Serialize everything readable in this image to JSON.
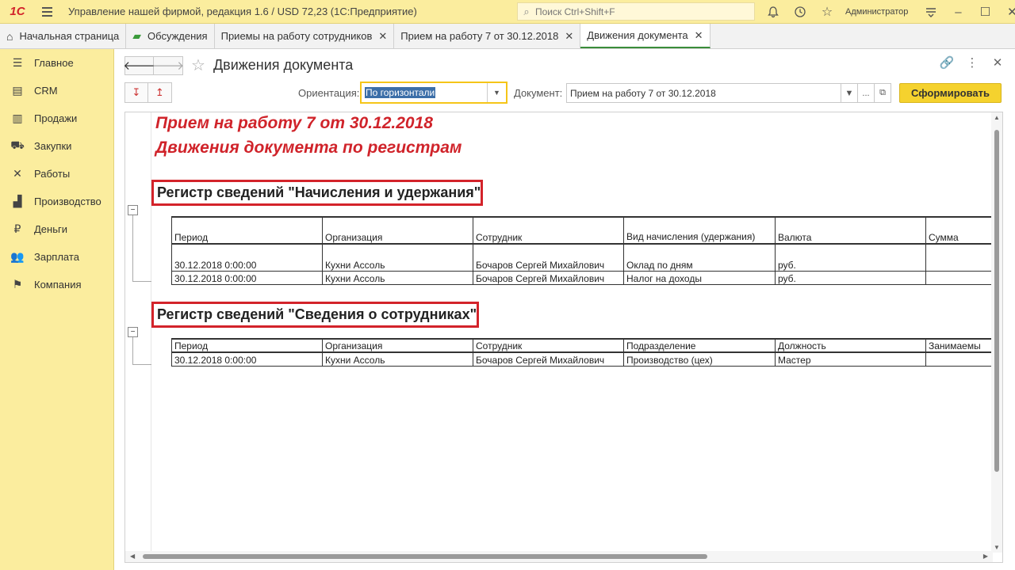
{
  "titlebar": {
    "logo": "1С",
    "app_title": "Управление нашей фирмой, редакция 1.6 / USD 72,23  (1С:Предприятие)",
    "search_placeholder": "Поиск Ctrl+Shift+F",
    "user": "Администратор"
  },
  "tabs": [
    {
      "label": "Начальная страница",
      "icon": "home-icon"
    },
    {
      "label": "Обсуждения",
      "icon": "chat-icon"
    },
    {
      "label": "Приемы на работу сотрудников",
      "close": "✕"
    },
    {
      "label": "Прием на работу 7 от 30.12.2018",
      "close": "✕"
    },
    {
      "label": "Движения документа",
      "close": "✕",
      "active": true
    }
  ],
  "sidebar": {
    "items": [
      {
        "label": "Главное",
        "icon": "list-icon"
      },
      {
        "label": "CRM",
        "icon": "crm-icon"
      },
      {
        "label": "Продажи",
        "icon": "basket-icon"
      },
      {
        "label": "Закупки",
        "icon": "truck-icon"
      },
      {
        "label": "Работы",
        "icon": "tools-icon"
      },
      {
        "label": "Производство",
        "icon": "factory-icon"
      },
      {
        "label": "Деньги",
        "icon": "ruble-icon"
      },
      {
        "label": "Зарплата",
        "icon": "people-icon"
      },
      {
        "label": "Компания",
        "icon": "flag-icon"
      }
    ]
  },
  "form": {
    "title": "Движения документа",
    "orientation_label": "Ориентация:",
    "orientation_value": "По горизонтали",
    "document_label": "Документ:",
    "document_value": "Прием на работу 7 от 30.12.2018",
    "generate_button": "Сформировать",
    "more_button": "..."
  },
  "report": {
    "title1": "Прием на работу 7 от 30.12.2018",
    "title2": "Движения документа по регистрам",
    "register1": {
      "title": "Регистр сведений \"Начисления и удержания\"",
      "columns": [
        "Период",
        "Организация",
        "Сотрудник",
        "Вид начисления (удержания)",
        "Валюта",
        "Сумма"
      ],
      "rows": [
        [
          "30.12.2018 0:00:00",
          "Кухни Ассоль",
          "Бочаров Сергей Михайлович",
          "Оклад по дням",
          "руб.",
          ""
        ],
        [
          "30.12.2018 0:00:00",
          "Кухни Ассоль",
          "Бочаров Сергей Михайлович",
          "Налог на доходы",
          "руб.",
          ""
        ]
      ]
    },
    "register2": {
      "title": "Регистр сведений \"Сведения о сотрудниках\"",
      "columns": [
        "Период",
        "Организация",
        "Сотрудник",
        "Подразделение",
        "Должность",
        "Занимаемы"
      ],
      "rows": [
        [
          "30.12.2018 0:00:00",
          "Кухни Ассоль",
          "Бочаров Сергей Михайлович",
          "Производство (цех)",
          "Мастер",
          ""
        ]
      ]
    }
  }
}
